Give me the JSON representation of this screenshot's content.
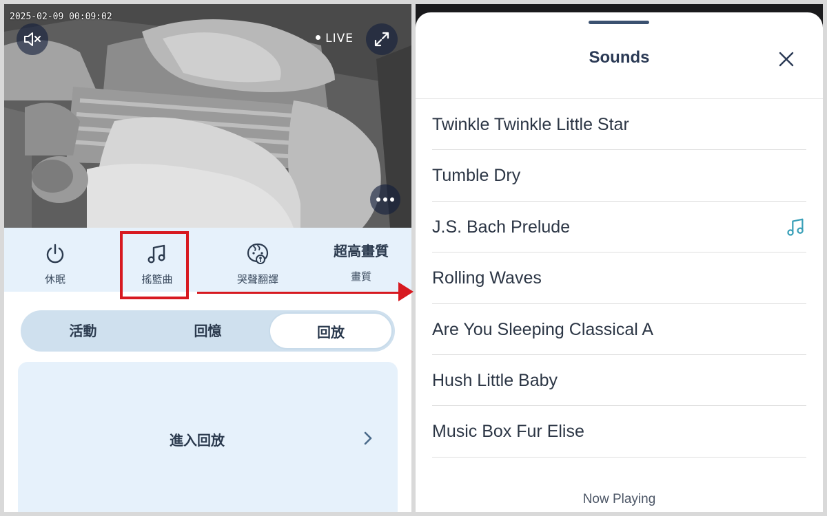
{
  "camera": {
    "timestamp": "2025-02-09 00:09:02",
    "live_label": "LIVE",
    "mute_icon": "speaker-muted-icon",
    "fullscreen_icon": "expand-icon",
    "more_icon": "more-dots-icon"
  },
  "toolbar": {
    "items": [
      {
        "label": "休眠",
        "icon": "power-icon"
      },
      {
        "label": "搖籃曲",
        "icon": "music-note-icon"
      },
      {
        "label": "哭聲翻譯",
        "icon": "baby-face-icon"
      },
      {
        "label": "畫質",
        "value": "超高畫質"
      }
    ]
  },
  "tabs": {
    "items": [
      "活動",
      "回憶",
      "回放"
    ],
    "active": "回放"
  },
  "playback": {
    "label": "進入回放"
  },
  "sounds_sheet": {
    "title": "Sounds",
    "items": [
      {
        "name": "Twinkle Twinkle Little Star"
      },
      {
        "name": "Tumble Dry"
      },
      {
        "name": "J.S. Bach Prelude",
        "playing": true
      },
      {
        "name": "Rolling Waves"
      },
      {
        "name": "Are You Sleeping Classical A"
      },
      {
        "name": "Hush Little Baby"
      },
      {
        "name": "Music Box Fur Elise"
      }
    ],
    "now_playing_label": "Now Playing"
  },
  "colors": {
    "highlight": "#d71920",
    "accent": "#3aa0b8",
    "toolbar_bg": "#e6f1fb",
    "text_dark": "#2b3a55"
  }
}
